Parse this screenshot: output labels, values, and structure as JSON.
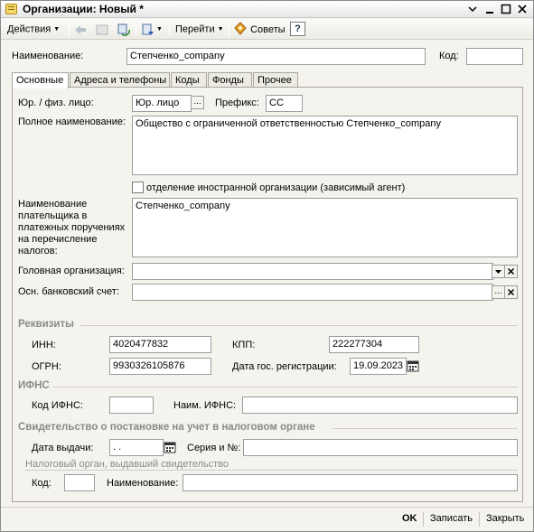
{
  "window": {
    "title": "Организации: Новый *"
  },
  "toolbar": {
    "actions_label": "Действия",
    "goto_label": "Перейти",
    "tips_label": "Советы",
    "help_label": "?"
  },
  "header": {
    "name_label": "Наименование:",
    "name_value": "Степченко_company",
    "code_label": "Код:",
    "code_value": ""
  },
  "tabs": [
    "Основные",
    "Адреса и телефоны",
    "Коды",
    "Фонды",
    "Прочее"
  ],
  "main": {
    "legal_label": "Юр. / физ. лицо:",
    "legal_value": "Юр. лицо",
    "prefix_label": "Префикс:",
    "prefix_value": "СС",
    "fullname_label": "Полное наименование:",
    "fullname_value": "Общество с ограниченной ответственностью Степченко_company",
    "foreign_branch_label": "отделение иностранной организации (зависимый агент)",
    "payer_label": "Наименование плательщика в платежных поручениях на перечисление налогов:",
    "payer_value": "Степченко_company",
    "head_org_label": "Головная организация:",
    "head_org_value": "",
    "bank_label": "Осн. банковский счет:",
    "bank_value": ""
  },
  "requisites": {
    "section_label": "Реквизиты",
    "inn_label": "ИНН:",
    "inn_value": "4020477832",
    "kpp_label": "КПП:",
    "kpp_value": "222277304",
    "ogrn_label": "ОГРН:",
    "ogrn_value": "9930326105876",
    "reg_date_label": "Дата гос. регистрации:",
    "reg_date_value": "19.09.2023"
  },
  "ifns": {
    "section_label": "ИФНС",
    "code_label": "Код ИФНС:",
    "code_value": "",
    "name_label": "Наим. ИФНС:",
    "name_value": ""
  },
  "certificate": {
    "section_label": "Свидетельство о постановке на учет в налоговом органе",
    "issue_date_label": "Дата выдачи:",
    "issue_date_value": " .  .",
    "series_label": "Серия и №:",
    "series_value": "",
    "authority_label": "Налоговый орган, выдавший свидетельство",
    "auth_code_label": "Код:",
    "auth_code_value": "",
    "auth_name_label": "Наименование:",
    "auth_name_value": ""
  },
  "footer": {
    "ok_label": "OK",
    "save_label": "Записать",
    "close_label": "Закрыть"
  }
}
